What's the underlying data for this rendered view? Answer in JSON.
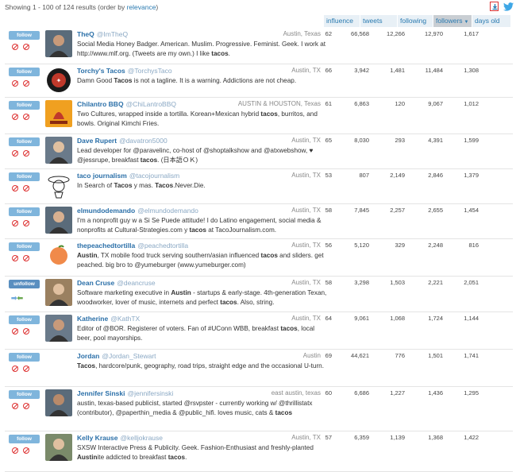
{
  "topbar": {
    "showing_text": "Showing 1 - 100 of 124 results (order by ",
    "order_link": "relevance",
    "showing_suffix": ")"
  },
  "columns": [
    {
      "key": "influence",
      "label": "influence",
      "active": false
    },
    {
      "key": "tweets",
      "label": "tweets",
      "active": false
    },
    {
      "key": "following",
      "label": "following",
      "active": false
    },
    {
      "key": "followers",
      "label": "followers",
      "active": true
    },
    {
      "key": "days_old",
      "label": "days old",
      "active": false
    }
  ],
  "colors": {
    "accent": "#2a7ab0",
    "follow": "#7fb5dc",
    "ban": "#dd3333"
  },
  "rows": [
    {
      "name": "TheQ",
      "handle": "@ImTheQ",
      "loc": "Austin, Texas",
      "bio": "Social Media Honey Badger. American. Muslim. Progressive. Feminist. Geek. I work at http://www.mlf.org. (Tweets are my own.) I like tacos.",
      "influence": "62",
      "tweets": "66,568",
      "following": "12,266",
      "followers": "12,970",
      "days_old": "1,617",
      "btn": "follow",
      "avatar": "person-photo"
    },
    {
      "name": "Torchy's Tacos",
      "handle": "@TorchysTaco",
      "loc": "Austin, TX",
      "bio": "Damn Good Tacos is not a tagline. It is a warning. Addictions are not cheap.",
      "influence": "66",
      "tweets": "3,942",
      "following": "1,481",
      "followers": "11,484",
      "days_old": "1,308",
      "btn": "follow",
      "avatar": "torchys-logo"
    },
    {
      "name": "Chilantro BBQ",
      "handle": "@ChiLantroBBQ",
      "loc": "AUSTIN & HOUSTON, Texas",
      "bio": "Two Cultures, wrapped inside a tortilla. Korean+Mexican hybrid tacos, burritos, and bowls. Original Kimchi Fries.",
      "influence": "61",
      "tweets": "6,863",
      "following": "120",
      "followers": "9,067",
      "days_old": "1,012",
      "btn": "follow",
      "avatar": "chilantro-logo"
    },
    {
      "name": "Dave Rupert",
      "handle": "@davatron5000",
      "loc": "Austin, TX",
      "bio": "Lead developer for @paravelinc, co-host of @shoptalkshow and @atxwebshow, ♥ @jessrupe, breakfast tacos. (日本語ＯＫ)",
      "influence": "65",
      "tweets": "8,030",
      "following": "293",
      "followers": "4,391",
      "days_old": "1,599",
      "btn": "follow",
      "avatar": "person-photo"
    },
    {
      "name": "taco journalism",
      "handle": "@tacojournalism",
      "loc": "Austin, TX",
      "bio": "In Search of Tacos y mas. Tacos.Never.Die.",
      "influence": "53",
      "tweets": "807",
      "following": "2,149",
      "followers": "2,846",
      "days_old": "1,379",
      "btn": "follow",
      "avatar": "taco-character"
    },
    {
      "name": "elmundodemando",
      "handle": "@elmundodemando",
      "loc": "Austin, TX",
      "bio": "I'm a nonprofit guy w a Si Se Puede attitude! I do Latino engagement, social media & nonprofits at Cultural-Strategies.com y tacos at TacoJournalism.com.",
      "influence": "58",
      "tweets": "7,845",
      "following": "2,257",
      "followers": "2,655",
      "days_old": "1,454",
      "btn": "follow",
      "avatar": "person-photo"
    },
    {
      "name": "thepeachedtortilla",
      "handle": "@peachedtortilla",
      "loc": "Austin, TX",
      "bio": "Austin, TX mobile food truck serving southern/asian influenced tacos and sliders. get peached. big bro to @yumeburger (www.yumeburger.com)",
      "influence": "56",
      "tweets": "5,120",
      "following": "329",
      "followers": "2,248",
      "days_old": "816",
      "btn": "follow",
      "avatar": "peach-logo"
    },
    {
      "name": "Dean Cruse",
      "handle": "@deancruse",
      "loc": "Austin, TX",
      "bio": "Software marketing executive in Austin - startups & early-stage. 4th-generation Texan, woodworker, lover of music, internets and perfect tacos. Also, string.",
      "influence": "58",
      "tweets": "3,298",
      "following": "1,503",
      "followers": "2,221",
      "days_old": "2,051",
      "btn": "unfollow",
      "avatar": "person-photo"
    },
    {
      "name": "Katherine",
      "handle": "@KathTX",
      "loc": "Austin, TX",
      "bio": "Editor of @BOR. Registerer of voters. Fan of #UConn WBB, breakfast tacos, local beer, pool mayorships.",
      "influence": "64",
      "tweets": "9,061",
      "following": "1,068",
      "followers": "1,724",
      "days_old": "1,144",
      "btn": "follow",
      "avatar": "person-photo"
    },
    {
      "name": "Jordan",
      "handle": "@Jordan_Stewart",
      "loc": "Austin",
      "bio": "Tacos, hardcore/punk, geography, road trips, straight edge and the occasional U-turn.",
      "influence": "69",
      "tweets": "44,621",
      "following": "776",
      "followers": "1,501",
      "days_old": "1,741",
      "btn": "follow",
      "avatar": "blank"
    },
    {
      "name": "Jennifer Sinski",
      "handle": "@jennifersinski",
      "loc": "east austin, texas",
      "bio": "austin, texas-based publicist, started @rsvpster - currently working w/ @thrillistatx (contributor), @paperthin_media & @public_hifi. loves music, cats & tacos",
      "influence": "60",
      "tweets": "6,686",
      "following": "1,227",
      "followers": "1,436",
      "days_old": "1,295",
      "btn": "follow",
      "avatar": "person-photo"
    },
    {
      "name": "Kelly Krause",
      "handle": "@kelljokrause",
      "loc": "Austin, TX",
      "bio": "SXSW Interactive Press & Publicity. Geek. Fashion-Enthusiast and freshly-planted Austinite addicted to breakfast tacos.",
      "influence": "57",
      "tweets": "6,359",
      "following": "1,139",
      "followers": "1,368",
      "days_old": "1,422",
      "btn": "follow",
      "avatar": "person-photo"
    }
  ]
}
